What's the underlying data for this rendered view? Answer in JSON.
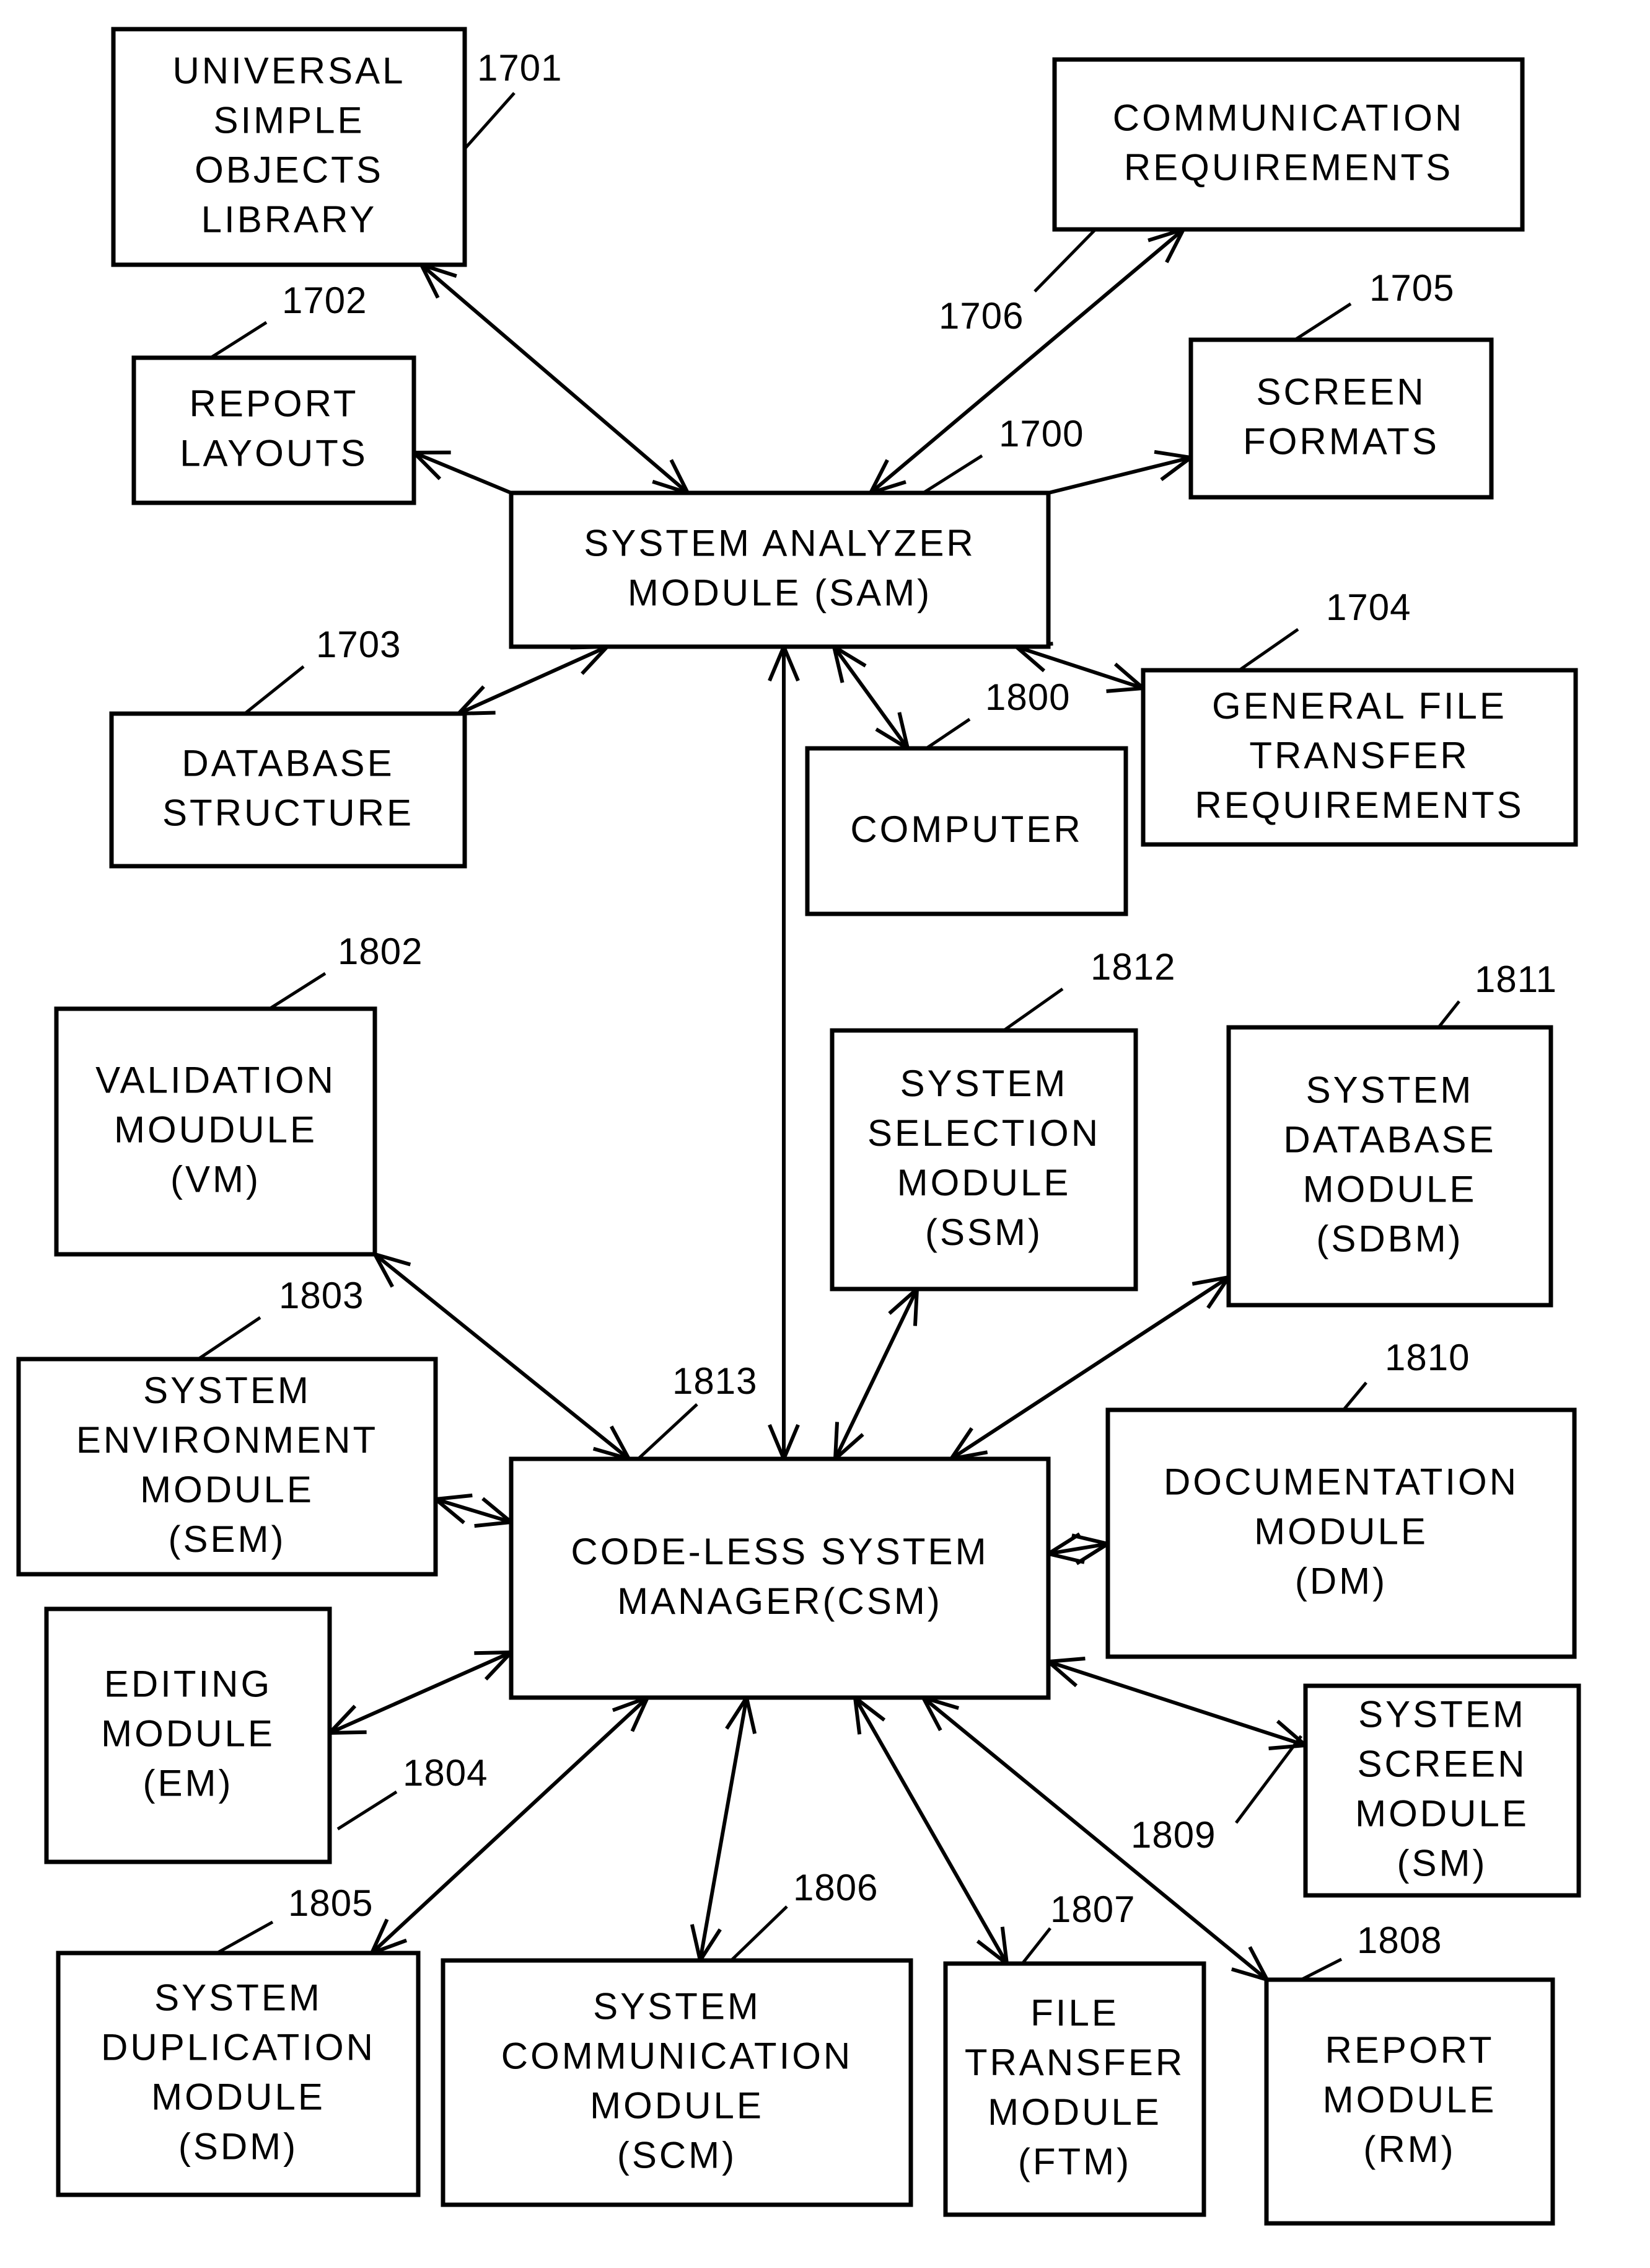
{
  "figure": {
    "description": "Block diagram: System Analyzer Module and Code-Less System Manager with connected modules"
  },
  "nodes": [
    {
      "id": "usol",
      "ref": "1701",
      "lines": [
        "UNIVERSAL",
        "SIMPLE",
        "OBJECTS",
        "LIBRARY"
      ]
    },
    {
      "id": "comm_req",
      "ref": "1706",
      "lines": [
        "COMMUNICATION",
        "REQUIREMENTS"
      ]
    },
    {
      "id": "report_layouts",
      "ref": "1702",
      "lines": [
        "REPORT",
        "LAYOUTS"
      ]
    },
    {
      "id": "screen_formats",
      "ref": "1705",
      "lines": [
        "SCREEN",
        "FORMATS"
      ]
    },
    {
      "id": "sam",
      "ref": "1700",
      "lines": [
        "SYSTEM ANALYZER",
        "MODULE (SAM)"
      ]
    },
    {
      "id": "db_structure",
      "ref": "1703",
      "lines": [
        "DATABASE",
        "STRUCTURE"
      ]
    },
    {
      "id": "gftr",
      "ref": "1704",
      "lines": [
        "GENERAL FILE",
        "TRANSFER",
        "REQUIREMENTS"
      ]
    },
    {
      "id": "computer",
      "ref": "1800",
      "lines": [
        "COMPUTER"
      ]
    },
    {
      "id": "vm",
      "ref": "1802",
      "lines": [
        "VALIDATION",
        "MOUDULE",
        "(VM)"
      ]
    },
    {
      "id": "ssm",
      "ref": "1812",
      "lines": [
        "SYSTEM",
        "SELECTION",
        "MODULE",
        "(SSM)"
      ]
    },
    {
      "id": "sdbm",
      "ref": "1811",
      "lines": [
        "SYSTEM",
        "DATABASE",
        "MODULE",
        "(SDBM)"
      ]
    },
    {
      "id": "sem",
      "ref": "1803",
      "lines": [
        "SYSTEM",
        "ENVIRONMENT",
        "MODULE",
        "(SEM)"
      ]
    },
    {
      "id": "dm",
      "ref": "1810",
      "lines": [
        "DOCUMENTATION",
        "MODULE",
        "(DM)"
      ]
    },
    {
      "id": "csm",
      "ref": "1813",
      "lines": [
        "CODE-LESS SYSTEM",
        "MANAGER(CSM)"
      ]
    },
    {
      "id": "em",
      "ref": "1804",
      "lines": [
        "EDITING",
        "MODULE",
        "(EM)"
      ]
    },
    {
      "id": "sm",
      "ref": "1809",
      "lines": [
        "SYSTEM",
        "SCREEN",
        "MODULE",
        "(SM)"
      ]
    },
    {
      "id": "sdm",
      "ref": "1805",
      "lines": [
        "SYSTEM",
        "DUPLICATION",
        "MODULE",
        "(SDM)"
      ]
    },
    {
      "id": "scm",
      "ref": "1806",
      "lines": [
        "SYSTEM",
        "COMMUNICATION",
        "MODULE",
        "(SCM)"
      ]
    },
    {
      "id": "ftm",
      "ref": "1807",
      "lines": [
        "FILE",
        "TRANSFER",
        "MODULE",
        "(FTM)"
      ]
    },
    {
      "id": "rm",
      "ref": "1808",
      "lines": [
        "REPORT",
        "MODULE",
        "(RM)"
      ]
    }
  ],
  "edges": [
    {
      "from": "sam",
      "to": "usol",
      "direction": "both"
    },
    {
      "from": "sam",
      "to": "report_layouts",
      "direction": "to"
    },
    {
      "from": "sam",
      "to": "comm_req",
      "direction": "both"
    },
    {
      "from": "sam",
      "to": "screen_formats",
      "direction": "to"
    },
    {
      "from": "sam",
      "to": "db_structure",
      "direction": "both"
    },
    {
      "from": "sam",
      "to": "gftr",
      "direction": "both"
    },
    {
      "from": "sam",
      "to": "computer",
      "direction": "both"
    },
    {
      "from": "sam",
      "to": "csm",
      "direction": "both"
    },
    {
      "from": "csm",
      "to": "vm",
      "direction": "both"
    },
    {
      "from": "csm",
      "to": "ssm",
      "direction": "both"
    },
    {
      "from": "csm",
      "to": "sdbm",
      "direction": "both"
    },
    {
      "from": "csm",
      "to": "sem",
      "direction": "both"
    },
    {
      "from": "csm",
      "to": "dm",
      "direction": "both"
    },
    {
      "from": "csm",
      "to": "em",
      "direction": "both"
    },
    {
      "from": "csm",
      "to": "sm",
      "direction": "both"
    },
    {
      "from": "csm",
      "to": "sdm",
      "direction": "both"
    },
    {
      "from": "csm",
      "to": "scm",
      "direction": "both"
    },
    {
      "from": "csm",
      "to": "ftm",
      "direction": "both"
    },
    {
      "from": "csm",
      "to": "rm",
      "direction": "both"
    }
  ]
}
